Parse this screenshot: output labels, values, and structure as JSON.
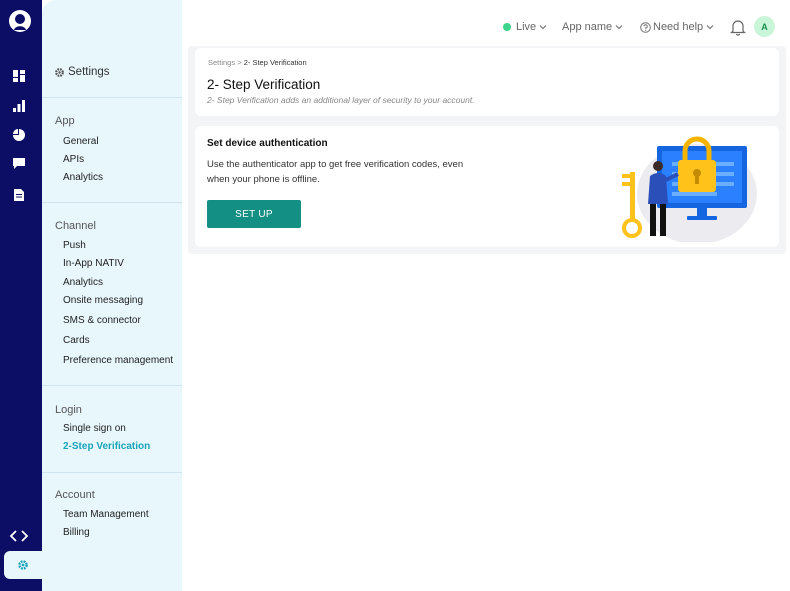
{
  "rail": {
    "icons": [
      "dashboard-icon",
      "bar-chart-icon",
      "pie-chart-icon",
      "chat-icon",
      "document-icon",
      "code-icon",
      "gear-icon"
    ]
  },
  "sidebar": {
    "title": "Settings",
    "sections": [
      {
        "label": "App",
        "items": [
          "General",
          "APIs",
          "Analytics"
        ]
      },
      {
        "label": "Channel",
        "items": [
          "Push",
          "In-App NATIV",
          "Analytics",
          "Onsite messaging",
          "SMS & connector",
          "Cards",
          "Preference management"
        ]
      },
      {
        "label": "Login",
        "items": [
          "Single sign on",
          "2-Step Verification"
        ]
      },
      {
        "label": "Account",
        "items": [
          "Team Management",
          "Billing"
        ]
      }
    ],
    "active_item": "2-Step Verification"
  },
  "topbar": {
    "live_label": "Live",
    "app_label": "App name",
    "help_label": "Need help",
    "avatar_initial": "A"
  },
  "header": {
    "breadcrumb_parent": "Settings",
    "breadcrumb_separator": ">",
    "breadcrumb_current": "2- Step Verification",
    "title": "2- Step Verification",
    "subtitle": "2- Step Verification adds an additional layer of security to your account."
  },
  "auth_card": {
    "title": "Set device authentication",
    "description": "Use the authenticator app to get free verification codes, even when your phone is offline.",
    "button_label": "SET UP"
  },
  "colors": {
    "rail": "#0c0d64",
    "sidebar": "#e8f7fc",
    "accent": "#19a3b8",
    "button": "#138f84",
    "live": "#3fd48a"
  }
}
